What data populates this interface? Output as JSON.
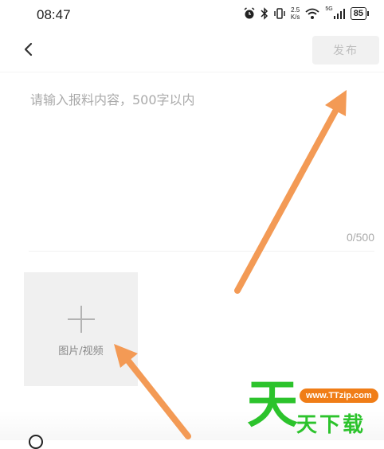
{
  "status_bar": {
    "time": "08:47",
    "speed_value": "2.5",
    "speed_unit": "K/s",
    "network": "5G",
    "battery": "85",
    "icons": [
      "alarm-icon",
      "bluetooth-icon",
      "vibrate-icon",
      "wifi-icon",
      "signal-icon",
      "battery-icon"
    ]
  },
  "header": {
    "back_icon": "chevron-left-icon",
    "publish_label": "发布"
  },
  "editor": {
    "placeholder": "请输入报料内容，500字以内",
    "value": "",
    "counter": "0/500"
  },
  "media": {
    "icon": "plus-icon",
    "label": "图片/视频"
  },
  "watermark": {
    "big_char": "天",
    "url": "www.TTzip.com",
    "text": "天下载"
  },
  "colors": {
    "arrow": "#f39a55",
    "publish_bg": "#f1f1f1",
    "publish_text": "#bdbdbd",
    "media_bg": "#f0f0f0",
    "watermark_green": "#2cc32c",
    "watermark_orange": "#f07d17"
  }
}
